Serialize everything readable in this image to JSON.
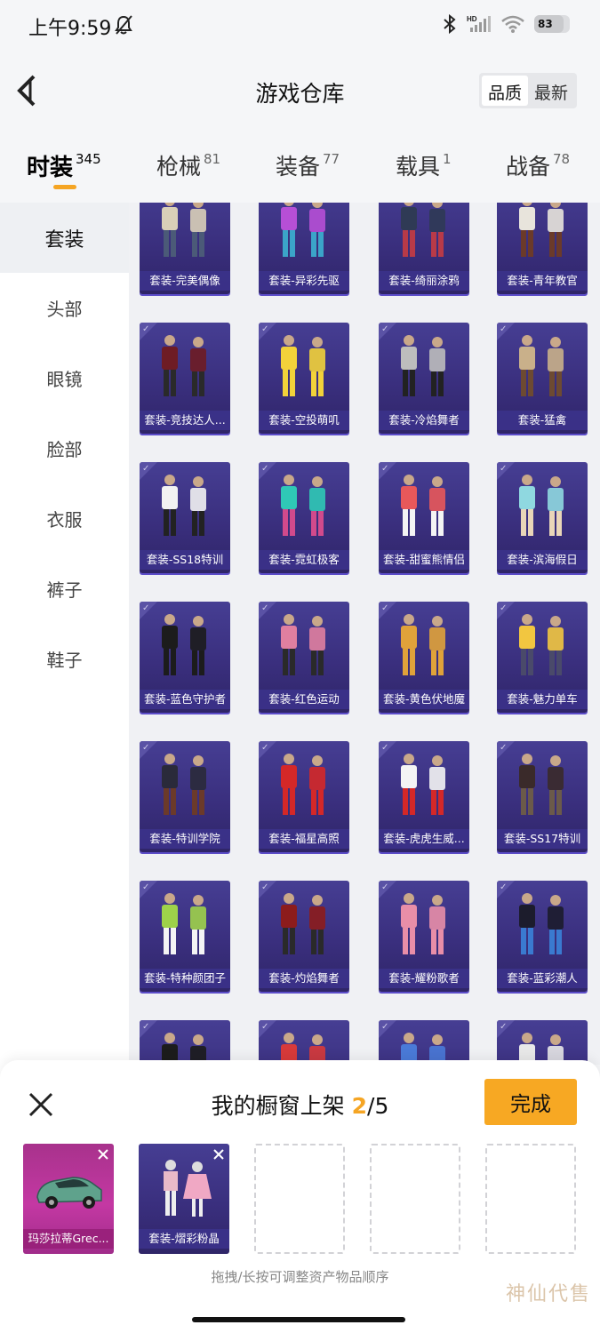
{
  "status_bar": {
    "time": "上午9:59",
    "battery": "83",
    "battery_level": 0.83
  },
  "header": {
    "title": "游戏仓库",
    "sort_options": [
      "品质",
      "最新"
    ],
    "sort_selected": "品质"
  },
  "tabs": [
    {
      "label": "时装",
      "count": "345",
      "active": true
    },
    {
      "label": "枪械",
      "count": "81",
      "active": false
    },
    {
      "label": "装备",
      "count": "77",
      "active": false
    },
    {
      "label": "载具",
      "count": "1",
      "active": false
    },
    {
      "label": "战备",
      "count": "78",
      "active": false
    }
  ],
  "sidebar": {
    "items": [
      {
        "label": "套装",
        "active": true
      },
      {
        "label": "头部",
        "active": false
      },
      {
        "label": "眼镜",
        "active": false
      },
      {
        "label": "脸部",
        "active": false
      },
      {
        "label": "衣服",
        "active": false
      },
      {
        "label": "裤子",
        "active": false
      },
      {
        "label": "鞋子",
        "active": false
      }
    ]
  },
  "items": [
    "套装-完美偶像",
    "套装-异彩先驱",
    "套装-绮丽涂鸦",
    "套装-青年教官",
    "套装-竞技达人...",
    "套装-空投萌叽",
    "套装-冷焰舞者",
    "套装-猛禽",
    "套装-SS18特训",
    "套装-霓虹极客",
    "套装-甜蜜熊情侣",
    "套装-滨海假日",
    "套装-蓝色守护者",
    "套装-红色运动",
    "套装-黄色伏地魔",
    "套装-魅力单车",
    "套装-特训学院",
    "套装-福星高照",
    "套装-虎虎生威...",
    "套装-SS17特训",
    "套装-特种颜团子",
    "套装-灼焰舞者",
    "套装-耀粉歌者",
    "套装-蓝彩潮人",
    "",
    "",
    "",
    ""
  ],
  "showcase": {
    "title": "我的橱窗上架",
    "current": "2",
    "separator": "/",
    "total": "5",
    "done_label": "完成",
    "slots": [
      {
        "label": "玛莎拉蒂Grec...",
        "filled": true
      },
      {
        "label": "套装-熠彩粉晶",
        "filled": true
      },
      {
        "label": "",
        "filled": false
      },
      {
        "label": "",
        "filled": false
      },
      {
        "label": "",
        "filled": false
      }
    ],
    "hint": "拖拽/长按可调整资产物品顺序"
  },
  "watermark": "神仙代售",
  "colors": {
    "accent": "#f5a524",
    "card_bg": "#3a2f7e",
    "card_highlight_purple": "#c438a3"
  }
}
